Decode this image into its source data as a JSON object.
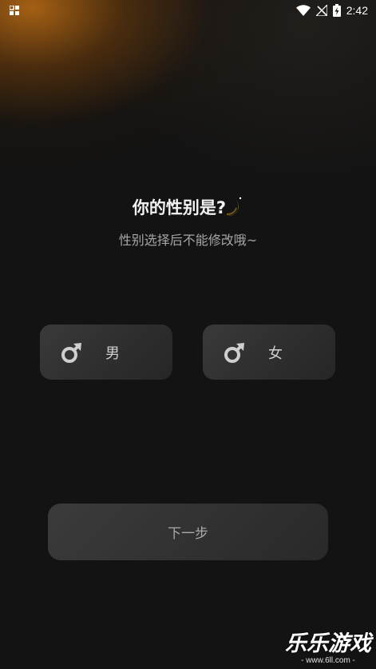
{
  "status_bar": {
    "time": "2:42",
    "icons": [
      "app-grid-icon",
      "wifi-icon",
      "no-signal-icon",
      "battery-charging-icon"
    ]
  },
  "header": {
    "title": "你的性别是?",
    "subtitle": "性别选择后不能修改哦~"
  },
  "gender_options": {
    "male_label": "男",
    "female_label": "女"
  },
  "next_button": {
    "label": "下一步"
  },
  "watermark": {
    "title": "乐乐游戏",
    "url": "- www.6ll.com -"
  },
  "colors": {
    "background": "#131313",
    "glow": "#be6e14",
    "button": "#333333",
    "moon": "#c9a43a"
  }
}
